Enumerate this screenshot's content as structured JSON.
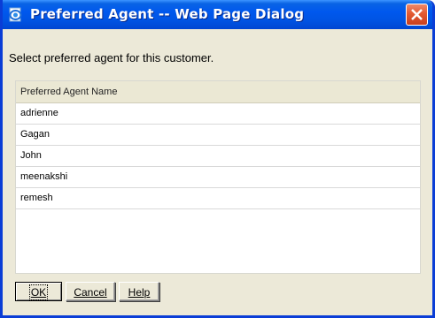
{
  "window": {
    "title": "Preferred Agent -- Web Page Dialog",
    "icon": "ie-page-icon",
    "close_icon": "close-icon"
  },
  "dialog": {
    "instruction": "Select preferred agent for this customer.",
    "grid": {
      "column_header": "Preferred Agent Name",
      "rows": [
        "adrienne",
        "Gagan",
        "John",
        "meenakshi",
        "remesh"
      ]
    },
    "buttons": {
      "ok": "OK",
      "cancel": "Cancel",
      "help": "Help"
    }
  },
  "colors": {
    "titlebar": "#0054e3",
    "close_button": "#e35a32",
    "dialog_bg": "#ece9d8",
    "header_bg": "#ebe8d4"
  }
}
